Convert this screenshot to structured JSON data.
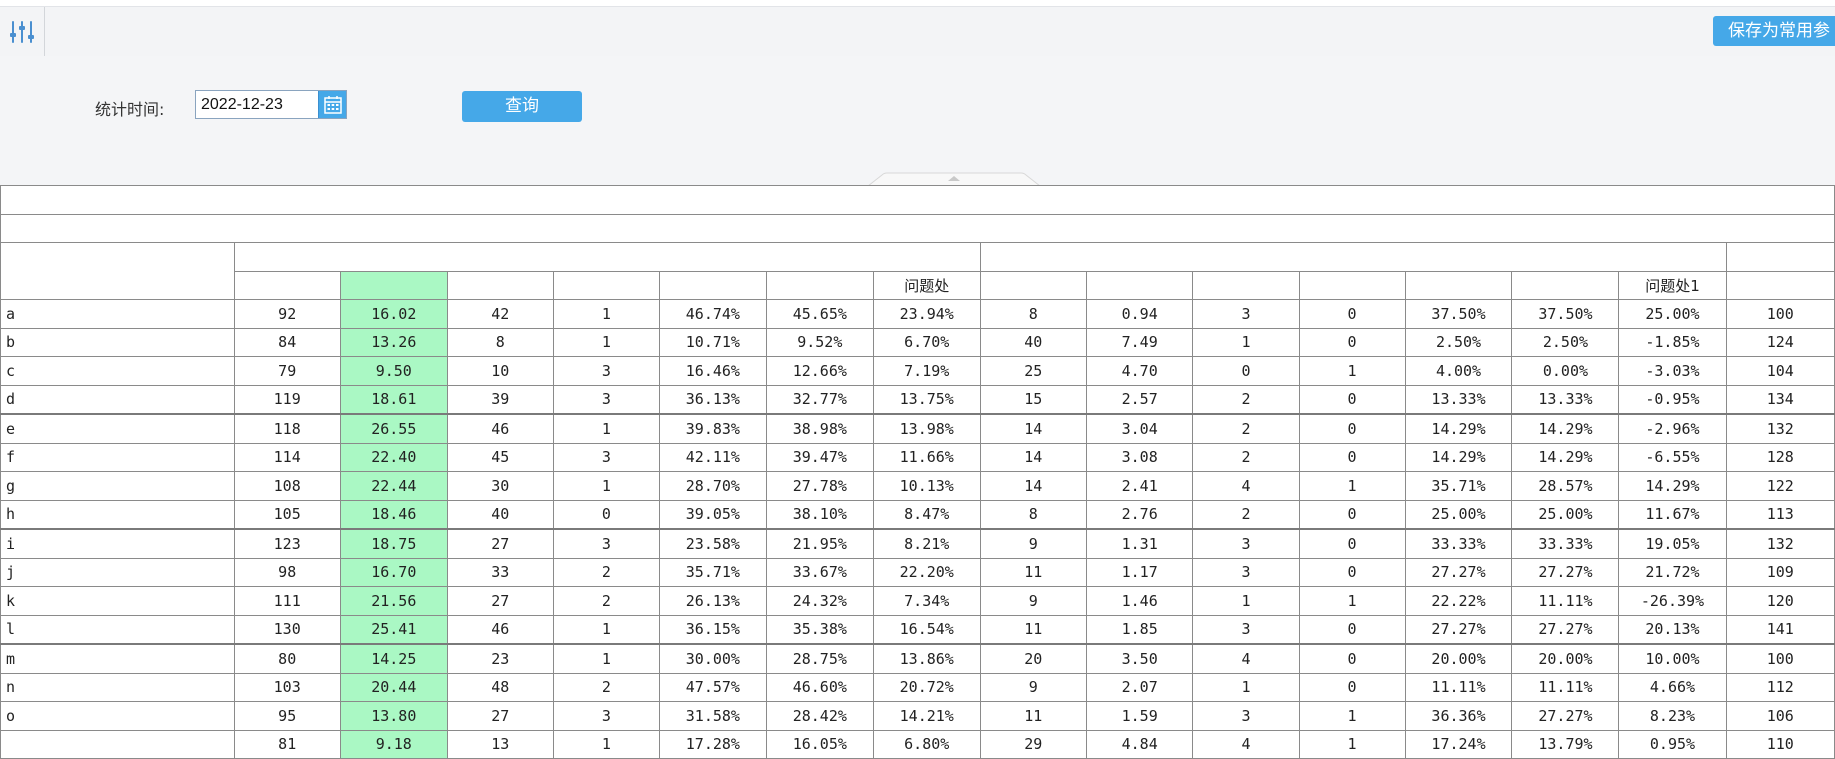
{
  "toolbar": {
    "settings_icon": "sliders-icon",
    "save_label": "保存为常用参"
  },
  "query": {
    "label": "统计时间:",
    "date_value": "2022-12-23",
    "calendar_icon": "calendar-icon",
    "button_label": "查询"
  },
  "table": {
    "header_group1_last": "问题处",
    "header_group2_last": "问题处1",
    "rows": [
      {
        "label": "a",
        "c": [
          "92",
          "16.02",
          "42",
          "1",
          "46.74%",
          "45.65%",
          "23.94%",
          "8",
          "0.94",
          "3",
          "0",
          "37.50%",
          "37.50%",
          "25.00%",
          "100"
        ]
      },
      {
        "label": "b",
        "c": [
          "84",
          "13.26",
          "8",
          "1",
          "10.71%",
          "9.52%",
          "6.70%",
          "40",
          "7.49",
          "1",
          "0",
          "2.50%",
          "2.50%",
          "-1.85%",
          "124"
        ]
      },
      {
        "label": "c",
        "c": [
          "79",
          "9.50",
          "10",
          "3",
          "16.46%",
          "12.66%",
          "7.19%",
          "25",
          "4.70",
          "0",
          "1",
          "4.00%",
          "0.00%",
          "-3.03%",
          "104"
        ]
      },
      {
        "label": "d",
        "c": [
          "119",
          "18.61",
          "39",
          "3",
          "36.13%",
          "32.77%",
          "13.75%",
          "15",
          "2.57",
          "2",
          "0",
          "13.33%",
          "13.33%",
          "-0.95%",
          "134"
        ]
      },
      {
        "label": "e",
        "c": [
          "118",
          "26.55",
          "46",
          "1",
          "39.83%",
          "38.98%",
          "13.98%",
          "14",
          "3.04",
          "2",
          "0",
          "14.29%",
          "14.29%",
          "-2.96%",
          "132"
        ]
      },
      {
        "label": "f",
        "c": [
          "114",
          "22.40",
          "45",
          "3",
          "42.11%",
          "39.47%",
          "11.66%",
          "14",
          "3.08",
          "2",
          "0",
          "14.29%",
          "14.29%",
          "-6.55%",
          "128"
        ]
      },
      {
        "label": "g",
        "c": [
          "108",
          "22.44",
          "30",
          "1",
          "28.70%",
          "27.78%",
          "10.13%",
          "14",
          "2.41",
          "4",
          "1",
          "35.71%",
          "28.57%",
          "14.29%",
          "122"
        ]
      },
      {
        "label": "h",
        "c": [
          "105",
          "18.46",
          "40",
          "0",
          "39.05%",
          "38.10%",
          "8.47%",
          "8",
          "2.76",
          "2",
          "0",
          "25.00%",
          "25.00%",
          "11.67%",
          "113"
        ]
      },
      {
        "label": "i",
        "c": [
          "123",
          "18.75",
          "27",
          "3",
          "23.58%",
          "21.95%",
          "8.21%",
          "9",
          "1.31",
          "3",
          "0",
          "33.33%",
          "33.33%",
          "19.05%",
          "132"
        ]
      },
      {
        "label": "j",
        "c": [
          "98",
          "16.70",
          "33",
          "2",
          "35.71%",
          "33.67%",
          "22.20%",
          "11",
          "1.17",
          "3",
          "0",
          "27.27%",
          "27.27%",
          "21.72%",
          "109"
        ]
      },
      {
        "label": "k",
        "c": [
          "111",
          "21.56",
          "27",
          "2",
          "26.13%",
          "24.32%",
          "7.34%",
          "9",
          "1.46",
          "1",
          "1",
          "22.22%",
          "11.11%",
          "-26.39%",
          "120"
        ]
      },
      {
        "label": "l",
        "c": [
          "130",
          "25.41",
          "46",
          "1",
          "36.15%",
          "35.38%",
          "16.54%",
          "11",
          "1.85",
          "3",
          "0",
          "27.27%",
          "27.27%",
          "20.13%",
          "141"
        ]
      },
      {
        "label": "m",
        "c": [
          "80",
          "14.25",
          "23",
          "1",
          "30.00%",
          "28.75%",
          "13.86%",
          "20",
          "3.50",
          "4",
          "0",
          "20.00%",
          "20.00%",
          "10.00%",
          "100"
        ]
      },
      {
        "label": "n",
        "c": [
          "103",
          "20.44",
          "48",
          "2",
          "47.57%",
          "46.60%",
          "20.72%",
          "9",
          "2.07",
          "1",
          "0",
          "11.11%",
          "11.11%",
          "4.66%",
          "112"
        ]
      },
      {
        "label": "o",
        "c": [
          "95",
          "13.80",
          "27",
          "3",
          "31.58%",
          "28.42%",
          "14.21%",
          "11",
          "1.59",
          "3",
          "1",
          "36.36%",
          "27.27%",
          "8.23%",
          "106"
        ]
      },
      {
        "label": "",
        "c": [
          "81",
          "9.18",
          "13",
          "1",
          "17.28%",
          "16.05%",
          "6.80%",
          "29",
          "4.84",
          "4",
          "1",
          "17.24%",
          "13.79%",
          "0.95%",
          "110"
        ]
      }
    ]
  }
}
